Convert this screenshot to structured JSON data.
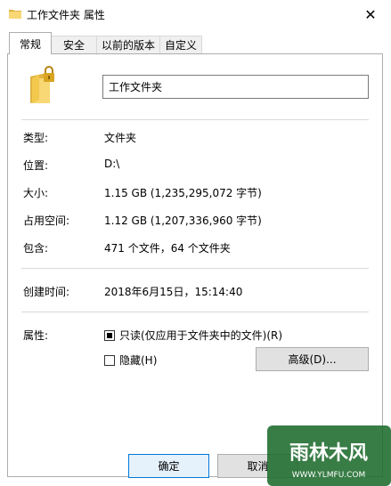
{
  "window": {
    "title": "工作文件夹 属性",
    "close_glyph": "✕"
  },
  "tabs": [
    {
      "label": "常规",
      "active": true
    },
    {
      "label": "安全",
      "active": false
    },
    {
      "label": "以前的版本",
      "active": false
    },
    {
      "label": "自定义",
      "active": false
    }
  ],
  "general": {
    "name_value": "工作文件夹",
    "type": {
      "label": "类型:",
      "value": "文件夹"
    },
    "location": {
      "label": "位置:",
      "value": "D:\\"
    },
    "size": {
      "label": "大小:",
      "value": "1.15 GB (1,235,295,072 字节)"
    },
    "size_on_disk": {
      "label": "占用空间:",
      "value": "1.12 GB (1,207,336,960 字节)"
    },
    "contains": {
      "label": "包含:",
      "value": "471 个文件，64 个文件夹"
    },
    "created": {
      "label": "创建时间:",
      "value": "2018年6月15日，15:14:40"
    },
    "attributes": {
      "label": "属性:",
      "readonly_label": "只读(仅应用于文件夹中的文件)(R)",
      "readonly_state": "indeterminate",
      "hidden_label": "隐藏(H)",
      "hidden_checked": false,
      "advanced_button": "高级(D)..."
    }
  },
  "buttons": {
    "ok": "确定",
    "cancel": "取消"
  },
  "watermark": {
    "text_main": "雨林木风",
    "text_url": "WWW.YLMFU.COM"
  },
  "colors": {
    "folder_yellow": "#f8d775",
    "folder_dark": "#e0b341",
    "lock_gold": "#d9a520",
    "accent_blue": "#0078d7"
  }
}
